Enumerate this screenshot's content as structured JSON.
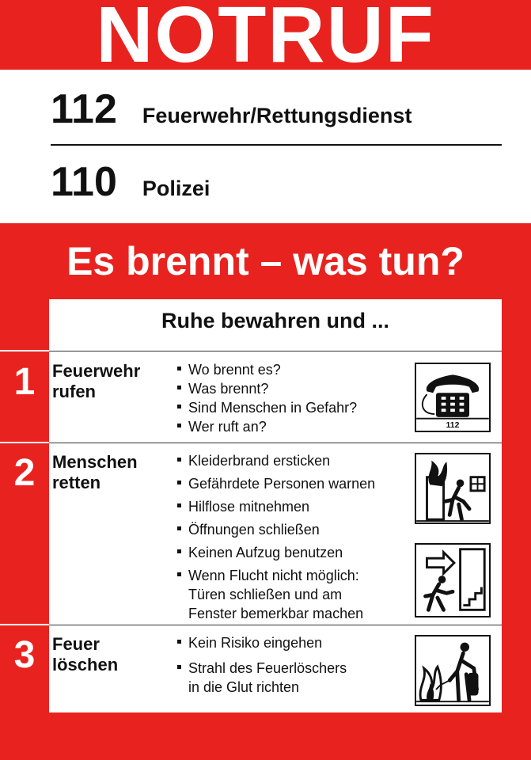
{
  "header": {
    "title": "NOTRUF"
  },
  "numbers": [
    {
      "number": "112",
      "label": "Feuerwehr/Rettungsdienst"
    },
    {
      "number": "110",
      "label": "Polizei"
    }
  ],
  "headline": "Es brennt – was tun?",
  "intro": "Ruhe bewahren und ...",
  "steps": [
    {
      "number": "1",
      "title_line1": "Feuerwehr",
      "title_line2": "rufen",
      "items": [
        "Wo brennt es?",
        "Was brennt?",
        "Sind Menschen in Gefahr?",
        "Wer ruft an?"
      ],
      "pictogram": "telephone-icon",
      "pictogram_label": "112"
    },
    {
      "number": "2",
      "title_line1": "Menschen",
      "title_line2": "retten",
      "items": [
        "Kleiderbrand ersticken",
        "Gefährdete Personen warnen",
        "Hilflose mitnehmen",
        "Öffnungen schließen",
        "Keinen Aufzug benutzen",
        "Wenn Flucht nicht möglich:",
        "Türen schließen und am",
        "Fenster bemerkbar machen"
      ],
      "pictograms": [
        "escape-burning-room-icon",
        "emergency-exit-stairs-icon"
      ]
    },
    {
      "number": "3",
      "title_line1": "Feuer",
      "title_line2": "löschen",
      "items": [
        "Kein Risiko eingehen",
        "Strahl des Feuerlöschers",
        "in die Glut richten"
      ],
      "pictogram": "fire-extinguisher-icon"
    }
  ],
  "colors": {
    "red": "#e8231f",
    "ink": "#111111",
    "white": "#ffffff"
  }
}
